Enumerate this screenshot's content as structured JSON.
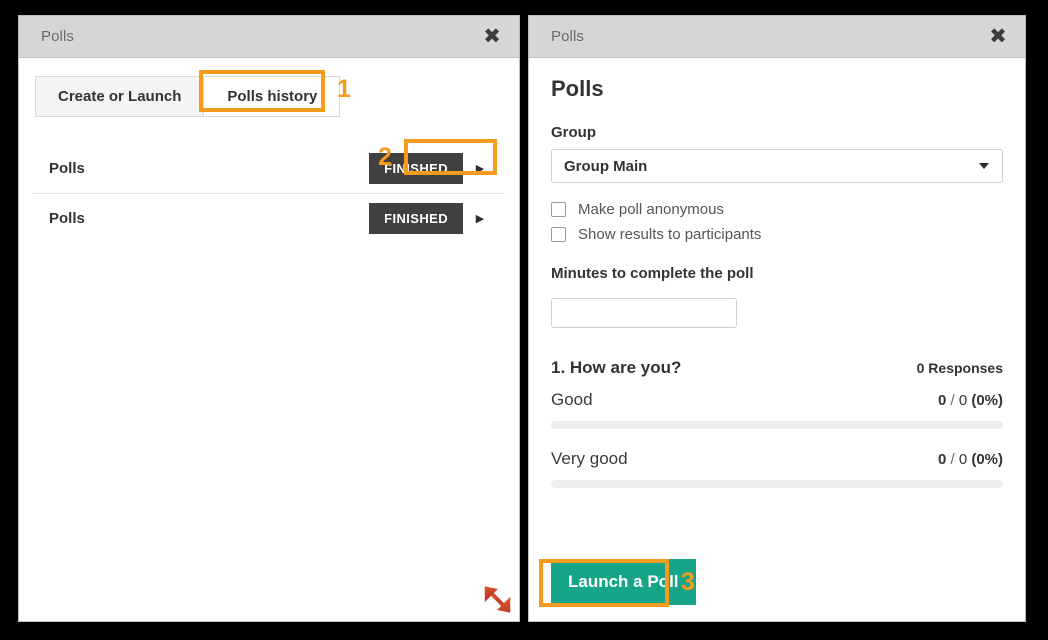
{
  "theme": {
    "frame": "#000000",
    "titlebar_bg": "#d6d6d6",
    "accent_orange": "#f59c1f",
    "badge_dark": "#404040",
    "launch_green": "#17a588",
    "resize_red": "#c0392b",
    "text_dark": "#333333",
    "track_gray": "#eceef0"
  },
  "left_panel": {
    "titlebar": {
      "title": "Polls",
      "close_icon": "close-icon"
    },
    "tabs": [
      {
        "label": "Create or Launch",
        "active": false
      },
      {
        "label": "Polls history",
        "active": true
      }
    ],
    "rows": [
      {
        "label": "Polls",
        "status": "FINISHED",
        "chevron_icon": "chevron-right-icon",
        "highlighted": true
      },
      {
        "label": "Polls",
        "status": "FINISHED",
        "chevron_icon": "chevron-right-icon",
        "highlighted": false
      }
    ],
    "resize_handle_icon": "resize-diagonal-arrow-icon"
  },
  "right_panel": {
    "titlebar": {
      "title": "Polls",
      "close_icon": "close-icon"
    },
    "heading": "Polls",
    "group": {
      "label": "Group",
      "selected": "Group Main",
      "caret_icon": "chevron-down-icon"
    },
    "options": [
      {
        "label": "Make poll anonymous",
        "checked": false
      },
      {
        "label": "Show results to participants",
        "checked": false
      }
    ],
    "minutes": {
      "label": "Minutes to complete the poll",
      "value": "",
      "placeholder": ""
    },
    "question": {
      "title": "1. How are you?",
      "responses": "0 Responses",
      "answers": [
        {
          "label": "Good",
          "votes": "0",
          "separator": " / ",
          "total": "0",
          "percent": "(0%)",
          "bar_percent": 0
        },
        {
          "label": "Very good",
          "votes": "0",
          "separator": " / ",
          "total": "0",
          "percent": "(0%)",
          "bar_percent": 0
        }
      ]
    },
    "launch_button": "Launch a Poll"
  },
  "annotations": [
    {
      "number": "1",
      "target": "polls-history-tab"
    },
    {
      "number": "2",
      "target": "finished-badge-row-1"
    },
    {
      "number": "3",
      "target": "launch-a-poll-button"
    }
  ]
}
